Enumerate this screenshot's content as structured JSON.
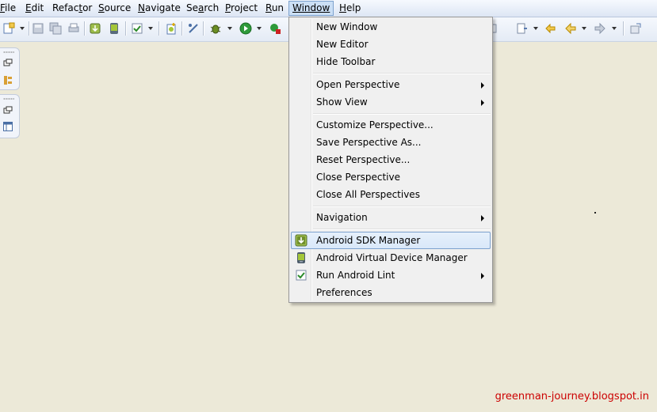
{
  "menubar": {
    "items": [
      {
        "label": "File"
      },
      {
        "label": "Edit"
      },
      {
        "label": "Refactor"
      },
      {
        "label": "Source"
      },
      {
        "label": "Navigate"
      },
      {
        "label": "Search"
      },
      {
        "label": "Project"
      },
      {
        "label": "Run"
      },
      {
        "label": "Window"
      },
      {
        "label": "Help"
      }
    ],
    "active": "Window"
  },
  "colors": {
    "background": "#ece9d8",
    "menu_highlight": "#cbdff5",
    "menu_highlight_border": "#7da2ce",
    "watermark": "#cc0000"
  },
  "window_menu": {
    "groups": [
      [
        {
          "label": "New Window"
        },
        {
          "label": "New Editor"
        },
        {
          "label": "Hide Toolbar"
        }
      ],
      [
        {
          "label": "Open Perspective",
          "submenu": true
        },
        {
          "label": "Show View",
          "submenu": true
        }
      ],
      [
        {
          "label": "Customize Perspective..."
        },
        {
          "label": "Save Perspective As..."
        },
        {
          "label": "Reset Perspective..."
        },
        {
          "label": "Close Perspective"
        },
        {
          "label": "Close All Perspectives"
        }
      ],
      [
        {
          "label": "Navigation",
          "submenu": true
        }
      ],
      [
        {
          "label": "Android SDK Manager",
          "icon": "android-sdk-manager-icon",
          "highlighted": true
        },
        {
          "label": "Android Virtual Device Manager",
          "icon": "android-avd-icon"
        },
        {
          "label": "Run Android Lint",
          "icon": "lint-check-icon",
          "submenu": true
        },
        {
          "label": "Preferences"
        }
      ]
    ]
  },
  "watermark": "greenman-journey.blogspot.in"
}
